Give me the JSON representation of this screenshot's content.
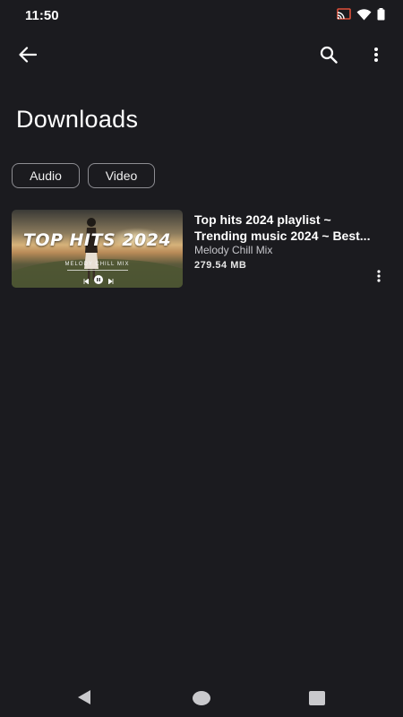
{
  "status_bar": {
    "time": "11:50",
    "icons": [
      "cast-icon",
      "wifi-icon",
      "battery-icon"
    ]
  },
  "app_bar": {
    "back_icon": "arrow-back-icon",
    "search_icon": "search-icon",
    "overflow_icon": "more-vert-icon"
  },
  "page": {
    "title": "Downloads"
  },
  "filters": [
    {
      "label": "Audio"
    },
    {
      "label": "Video"
    }
  ],
  "downloads": [
    {
      "thumbnail_title": "TOP HITS 2024",
      "thumbnail_subtitle": "MELODY CHILL MIX",
      "title_line1": "Top hits 2024 playlist  ~",
      "title_line2": "Trending music 2024 ~ Best...",
      "artist": "Melody Chill Mix",
      "size": "279.54 MB"
    }
  ],
  "colors": {
    "background": "#1b1b1f",
    "text_primary": "#ffffff",
    "text_secondary": "#c6c6cb",
    "chip_border": "#8d8d92"
  }
}
